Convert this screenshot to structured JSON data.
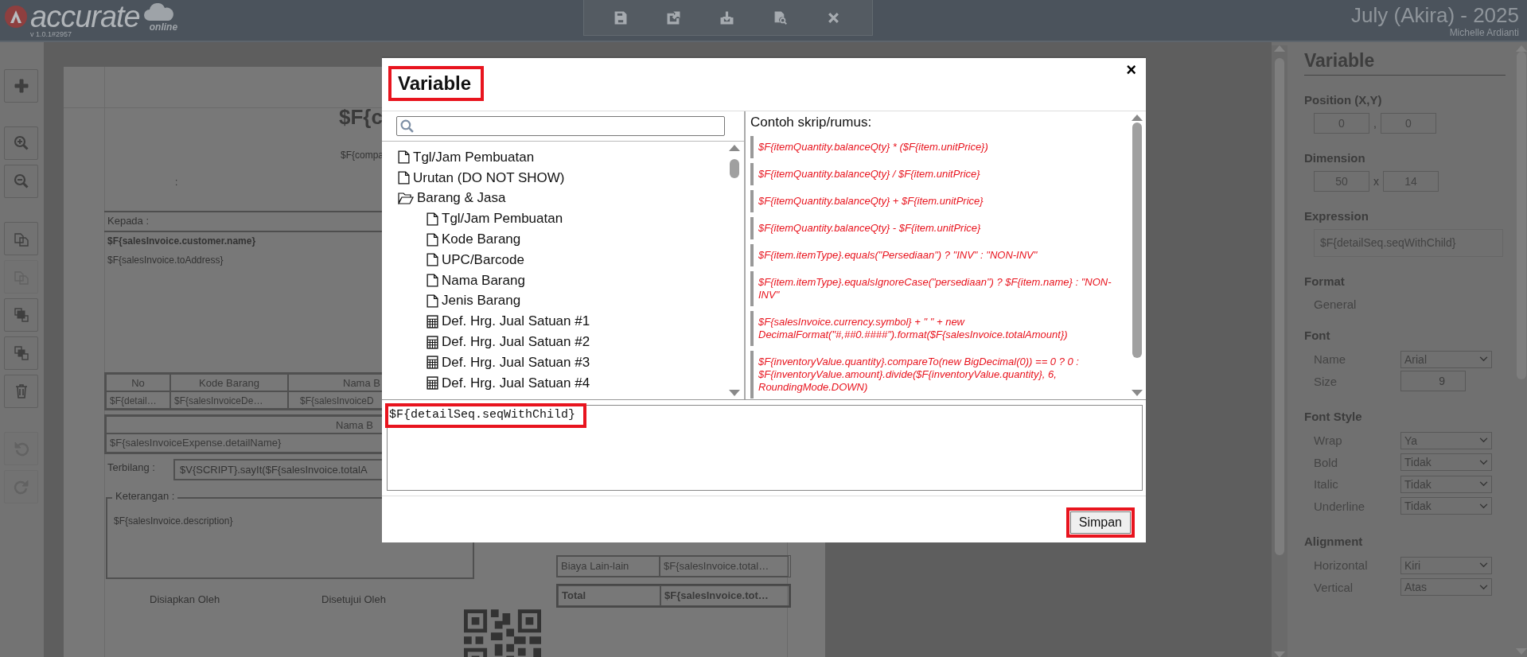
{
  "header": {
    "logo": {
      "name": "accurate",
      "tagline": "online",
      "version": "v 1.0.1#2957"
    },
    "toolbar": [
      {
        "kind": "save"
      },
      {
        "kind": "export"
      },
      {
        "kind": "import"
      },
      {
        "kind": "preview"
      },
      {
        "kind": "close"
      }
    ],
    "period": "July (Akira) - 2025",
    "user": "Michelle Ardianti"
  },
  "left_toolbar": [
    {
      "kind": "add",
      "disabled": false
    },
    {
      "kind": "zoom-in",
      "disabled": false
    },
    {
      "kind": "zoom-out",
      "disabled": false
    },
    {
      "kind": "copy",
      "disabled": false
    },
    {
      "kind": "paste",
      "disabled": true
    },
    {
      "kind": "bring-front",
      "disabled": false
    },
    {
      "kind": "send-back",
      "disabled": false
    },
    {
      "kind": "delete",
      "disabled": false
    },
    {
      "kind": "undo",
      "disabled": true
    },
    {
      "kind": "redo",
      "disabled": true
    }
  ],
  "document": {
    "company_name": "$F{c",
    "company_detail": "$F{compa",
    "colon": ":",
    "to_label": "Kepada :",
    "customer_name": "$F{salesInvoice.customer.name}",
    "address": "$F{salesInvoice.toAddress}",
    "items_table": {
      "columns": [
        "No",
        "Kode Barang",
        "Nama B"
      ],
      "row": [
        "$F{detail…",
        "$F{salesInvoiceDe…",
        "$F{salesInvoiceD"
      ]
    },
    "expense_table": {
      "column": "Nama B",
      "row": "$F{salesInvoiceExpense.detailName}"
    },
    "amount_words": {
      "label": "Terbilang :",
      "value": "$V{SCRIPT}.sayIt($F{salesInvoice.totalA"
    },
    "notes": {
      "label": "Keterangan :",
      "value": "$F{salesInvoice.description}"
    },
    "signatures": [
      "Disiapkan Oleh",
      "Disetujui Oleh"
    ],
    "totals": [
      {
        "kind": "line",
        "label": "Biaya Lain-lain",
        "value": "$F{salesInvoice.total…"
      },
      {
        "kind": "total",
        "label": "Total",
        "value": "$F{salesInvoice.tot…"
      }
    ]
  },
  "properties": {
    "title": "Variable",
    "sections": [
      {
        "kind": "pair",
        "title": "Position (X,Y)",
        "values": [
          "0",
          "0"
        ],
        "separator": ","
      },
      {
        "kind": "pair",
        "title": "Dimension",
        "values": [
          "50",
          "14"
        ],
        "separator": "x"
      },
      {
        "kind": "field",
        "title": "Expression",
        "value": "$F{detailSeq.seqWithChild}"
      },
      {
        "kind": "text",
        "title": "Format",
        "value": "General"
      },
      {
        "kind": "rows",
        "title": "Font",
        "rows": [
          {
            "kind": "select",
            "label": "Name",
            "value": "Arial"
          },
          {
            "kind": "number",
            "label": "Size",
            "value": "9"
          }
        ]
      },
      {
        "kind": "rows",
        "title": "Font Style",
        "rows": [
          {
            "kind": "select",
            "label": "Wrap",
            "value": "Ya"
          },
          {
            "kind": "select",
            "label": "Bold",
            "value": "Tidak"
          },
          {
            "kind": "select",
            "label": "Italic",
            "value": "Tidak"
          },
          {
            "kind": "select",
            "label": "Underline",
            "value": "Tidak"
          }
        ]
      },
      {
        "kind": "rows",
        "title": "Alignment",
        "rows": [
          {
            "kind": "select",
            "label": "Horizontal",
            "value": "Kiri"
          },
          {
            "kind": "select",
            "label": "Vertical",
            "value": "Atas"
          }
        ]
      }
    ]
  },
  "dialog": {
    "title": "Variable",
    "close": "×",
    "tree": [
      {
        "kind": "field",
        "label": "Tgl/Jam Pembuatan"
      },
      {
        "kind": "field",
        "label": "Urutan (DO NOT SHOW)"
      },
      {
        "kind": "folder",
        "label": "Barang & Jasa",
        "expanded": true,
        "children": [
          {
            "kind": "field",
            "label": "Tgl/Jam Pembuatan"
          },
          {
            "kind": "field",
            "label": "Kode Barang"
          },
          {
            "kind": "field",
            "label": "UPC/Barcode"
          },
          {
            "kind": "field",
            "label": "Nama Barang"
          },
          {
            "kind": "field",
            "label": "Jenis Barang"
          },
          {
            "kind": "number",
            "label": "Def. Hrg. Jual Satuan #1"
          },
          {
            "kind": "number",
            "label": "Def. Hrg. Jual Satuan #2"
          },
          {
            "kind": "number",
            "label": "Def. Hrg. Jual Satuan #3"
          },
          {
            "kind": "number",
            "label": "Def. Hrg. Jual Satuan #4"
          }
        ]
      }
    ],
    "examples_title": "Contoh skrip/rumus:",
    "examples": [
      "$F{itemQuantity.balanceQty} * ($F{item.unitPrice})",
      "$F{itemQuantity.balanceQty} / $F{item.unitPrice}",
      "$F{itemQuantity.balanceQty} + $F{item.unitPrice}",
      "$F{itemQuantity.balanceQty} - $F{item.unitPrice}",
      "$F{item.itemType}.equals(\"Persediaan\") ? \"INV\" : \"NON-INV\"",
      "$F{item.itemType}.equalsIgnoreCase(\"persediaan\") ? $F{item.name} : \"NON-INV\"",
      "$F{salesInvoice.currency.symbol} + \" \" + new DecimalFormat(\"#,##0.####\").format($F{salesInvoice.totalAmount})",
      "$F{inventoryValue.quantity}.compareTo(new BigDecimal(0)) == 0 ? 0 : $F{inventoryValue.amount}.divide($F{inventoryValue.quantity}, 6, RoundingMode.DOWN)"
    ],
    "expression": "$F{detailSeq.seqWithChild}",
    "save_button": "Simpan"
  }
}
